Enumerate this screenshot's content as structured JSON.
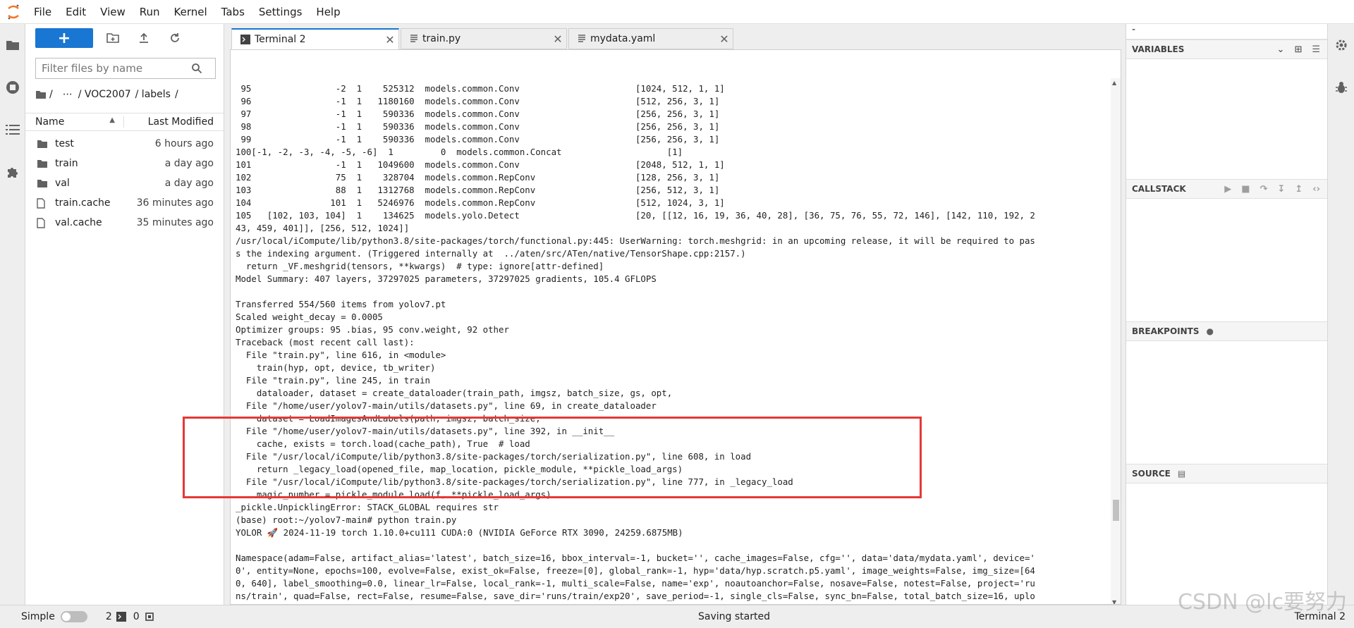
{
  "menubar": {
    "items": [
      "File",
      "Edit",
      "View",
      "Run",
      "Kernel",
      "Tabs",
      "Settings",
      "Help"
    ]
  },
  "filebrowser": {
    "new_label": "+",
    "filter_placeholder": "Filter files by name",
    "breadcrumb": [
      "/",
      "⋯",
      "/ VOC2007",
      "/ labels",
      "/"
    ],
    "col_name": "Name",
    "col_modified": "Last Modified",
    "files": [
      {
        "name": "test",
        "type": "folder",
        "modified": "6 hours ago"
      },
      {
        "name": "train",
        "type": "folder",
        "modified": "a day ago"
      },
      {
        "name": "val",
        "type": "folder",
        "modified": "a day ago"
      },
      {
        "name": "train.cache",
        "type": "file",
        "modified": "36 minutes ago"
      },
      {
        "name": "val.cache",
        "type": "file",
        "modified": "35 minutes ago"
      }
    ]
  },
  "tabs": [
    {
      "label": "Terminal 2",
      "icon": "terminal-icon",
      "active": true
    },
    {
      "label": "train.py",
      "icon": "text-file-icon",
      "active": false
    },
    {
      "label": "mydata.yaml",
      "icon": "text-file-icon",
      "active": false
    }
  ],
  "terminal": {
    "lines": [
      " 95                -2  1    525312  models.common.Conv                      [1024, 512, 1, 1]",
      " 96                -1  1   1180160  models.common.Conv                      [512, 256, 3, 1]",
      " 97                -1  1    590336  models.common.Conv                      [256, 256, 3, 1]",
      " 98                -1  1    590336  models.common.Conv                      [256, 256, 3, 1]",
      " 99                -1  1    590336  models.common.Conv                      [256, 256, 3, 1]",
      "100[-1, -2, -3, -4, -5, -6]  1         0  models.common.Concat                    [1]",
      "101                -1  1   1049600  models.common.Conv                      [2048, 512, 1, 1]",
      "102                75  1    328704  models.common.RepConv                   [128, 256, 3, 1]",
      "103                88  1   1312768  models.common.RepConv                   [256, 512, 3, 1]",
      "104               101  1   5246976  models.common.RepConv                   [512, 1024, 3, 1]",
      "105   [102, 103, 104]  1    134625  models.yolo.Detect                      [20, [[12, 16, 19, 36, 40, 28], [36, 75, 76, 55, 72, 146], [142, 110, 192, 2",
      "43, 459, 401]], [256, 512, 1024]]",
      "/usr/local/iCompute/lib/python3.8/site-packages/torch/functional.py:445: UserWarning: torch.meshgrid: in an upcoming release, it will be required to pas",
      "s the indexing argument. (Triggered internally at  ../aten/src/ATen/native/TensorShape.cpp:2157.)",
      "  return _VF.meshgrid(tensors, **kwargs)  # type: ignore[attr-defined]",
      "Model Summary: 407 layers, 37297025 parameters, 37297025 gradients, 105.4 GFLOPS",
      "",
      "Transferred 554/560 items from yolov7.pt",
      "Scaled weight_decay = 0.0005",
      "Optimizer groups: 95 .bias, 95 conv.weight, 92 other",
      "Traceback (most recent call last):",
      "  File \"train.py\", line 616, in <module>",
      "    train(hyp, opt, device, tb_writer)",
      "  File \"train.py\", line 245, in train",
      "    dataloader, dataset = create_dataloader(train_path, imgsz, batch_size, gs, opt,",
      "  File \"/home/user/yolov7-main/utils/datasets.py\", line 69, in create_dataloader",
      "    dataset = LoadImagesAndLabels(path, imgsz, batch_size,",
      "  File \"/home/user/yolov7-main/utils/datasets.py\", line 392, in __init__",
      "    cache, exists = torch.load(cache_path), True  # load",
      "  File \"/usr/local/iCompute/lib/python3.8/site-packages/torch/serialization.py\", line 608, in load",
      "    return _legacy_load(opened_file, map_location, pickle_module, **pickle_load_args)",
      "  File \"/usr/local/iCompute/lib/python3.8/site-packages/torch/serialization.py\", line 777, in _legacy_load",
      "    magic_number = pickle_module.load(f, **pickle_load_args)",
      "_pickle.UnpicklingError: STACK_GLOBAL requires str",
      "(base) root:~/yolov7-main# python train.py",
      "YOLOR 🚀 2024-11-19 torch 1.10.0+cu111 CUDA:0 (NVIDIA GeForce RTX 3090, 24259.6875MB)",
      "",
      "Namespace(adam=False, artifact_alias='latest', batch_size=16, bbox_interval=-1, bucket='', cache_images=False, cfg='', data='data/mydata.yaml', device='",
      "0', entity=None, epochs=100, evolve=False, exist_ok=False, freeze=[0], global_rank=-1, hyp='data/hyp.scratch.p5.yaml', image_weights=False, img_size=[64",
      "0, 640], label_smoothing=0.0, linear_lr=False, local_rank=-1, multi_scale=False, name='exp', noautoanchor=False, nosave=False, notest=False, project='ru",
      "ns/train', quad=False, rect=False, resume=False, save_dir='runs/train/exp20', save_period=-1, single_cls=False, sync_bn=False, total_batch_size=16, uplo",
      "ad_dataset=False, v5_metric=False, weights='yolov7.pt', workers=8, world_size=1)"
    ]
  },
  "debugger": {
    "title": "-",
    "sections": [
      "VARIABLES",
      "CALLSTACK",
      "BREAKPOINTS",
      "SOURCE"
    ]
  },
  "statusbar": {
    "mode_label": "Simple",
    "terminals_count": "2",
    "kernels_count": "0",
    "status_text": "Saving started",
    "active_label": "Terminal 2"
  },
  "watermark": "CSDN @lc要努力",
  "colors": {
    "accent": "#1976d2",
    "highlight_box": "#e53935"
  }
}
